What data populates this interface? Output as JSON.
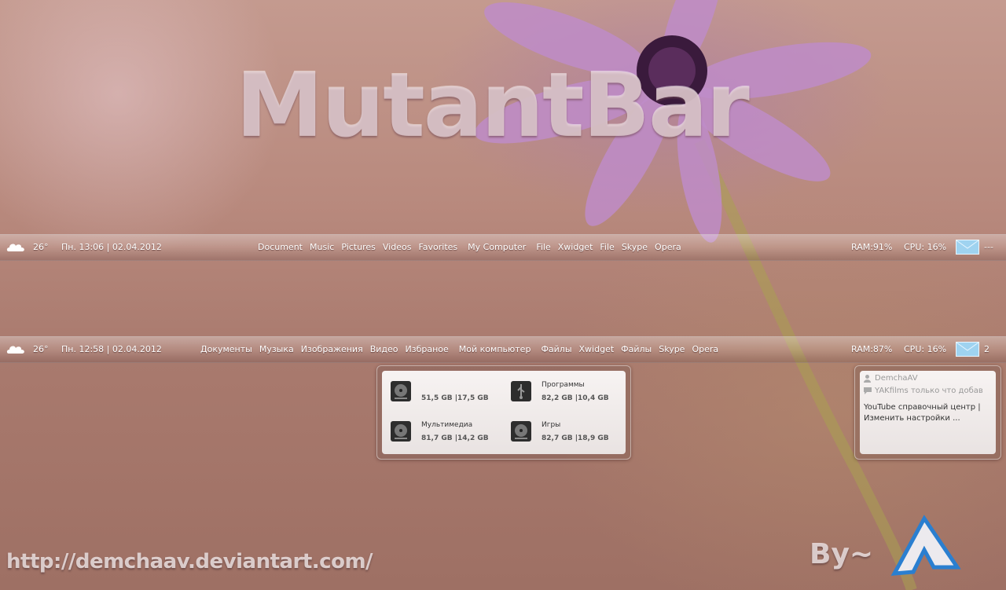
{
  "title": "MutantBar",
  "bar_top": {
    "temperature": "26°",
    "clock": "Пн. 13:06 | 02.04.2012",
    "menu": [
      "Document",
      "Music",
      "Pictures",
      "Videos",
      "Favorites",
      "My Computer",
      "File",
      "Xwidget",
      "File",
      "Skype",
      "Opera"
    ],
    "ram": "RAM:91%",
    "cpu": "CPU: 16%",
    "mail_count": "---"
  },
  "bar_bottom": {
    "temperature": "26°",
    "clock": "Пн. 12:58 | 02.04.2012",
    "menu": [
      "Документы",
      "Музыка",
      "Изображения",
      "Видео",
      "Избраное",
      "Мой компьютер",
      "Файлы",
      "Xwidget",
      "Файлы",
      "Skype",
      "Opera"
    ],
    "ram": "RAM:87%",
    "cpu": "CPU: 16%",
    "mail_count": "2"
  },
  "drives": [
    {
      "name": "",
      "size": "51,5 GB |17,5 GB"
    },
    {
      "name": "Программы",
      "size": "82,2 GB |10,4 GB"
    },
    {
      "name": "Мультимедиа",
      "size": "81,7 GB |14,2 GB"
    },
    {
      "name": "Игры",
      "size": "82,7 GB |18,9 GB"
    }
  ],
  "skype": {
    "user": "DemchaAV",
    "notice": "YAKfilms только что добав",
    "message": "YouTube справочный центр | Изменить настройки ..."
  },
  "footer": {
    "url": "http://demchaav.deviantart.com/",
    "by": "By~"
  },
  "colors": {
    "mail_icon": "#9fd3f0",
    "bar_text": "#ffffff"
  }
}
